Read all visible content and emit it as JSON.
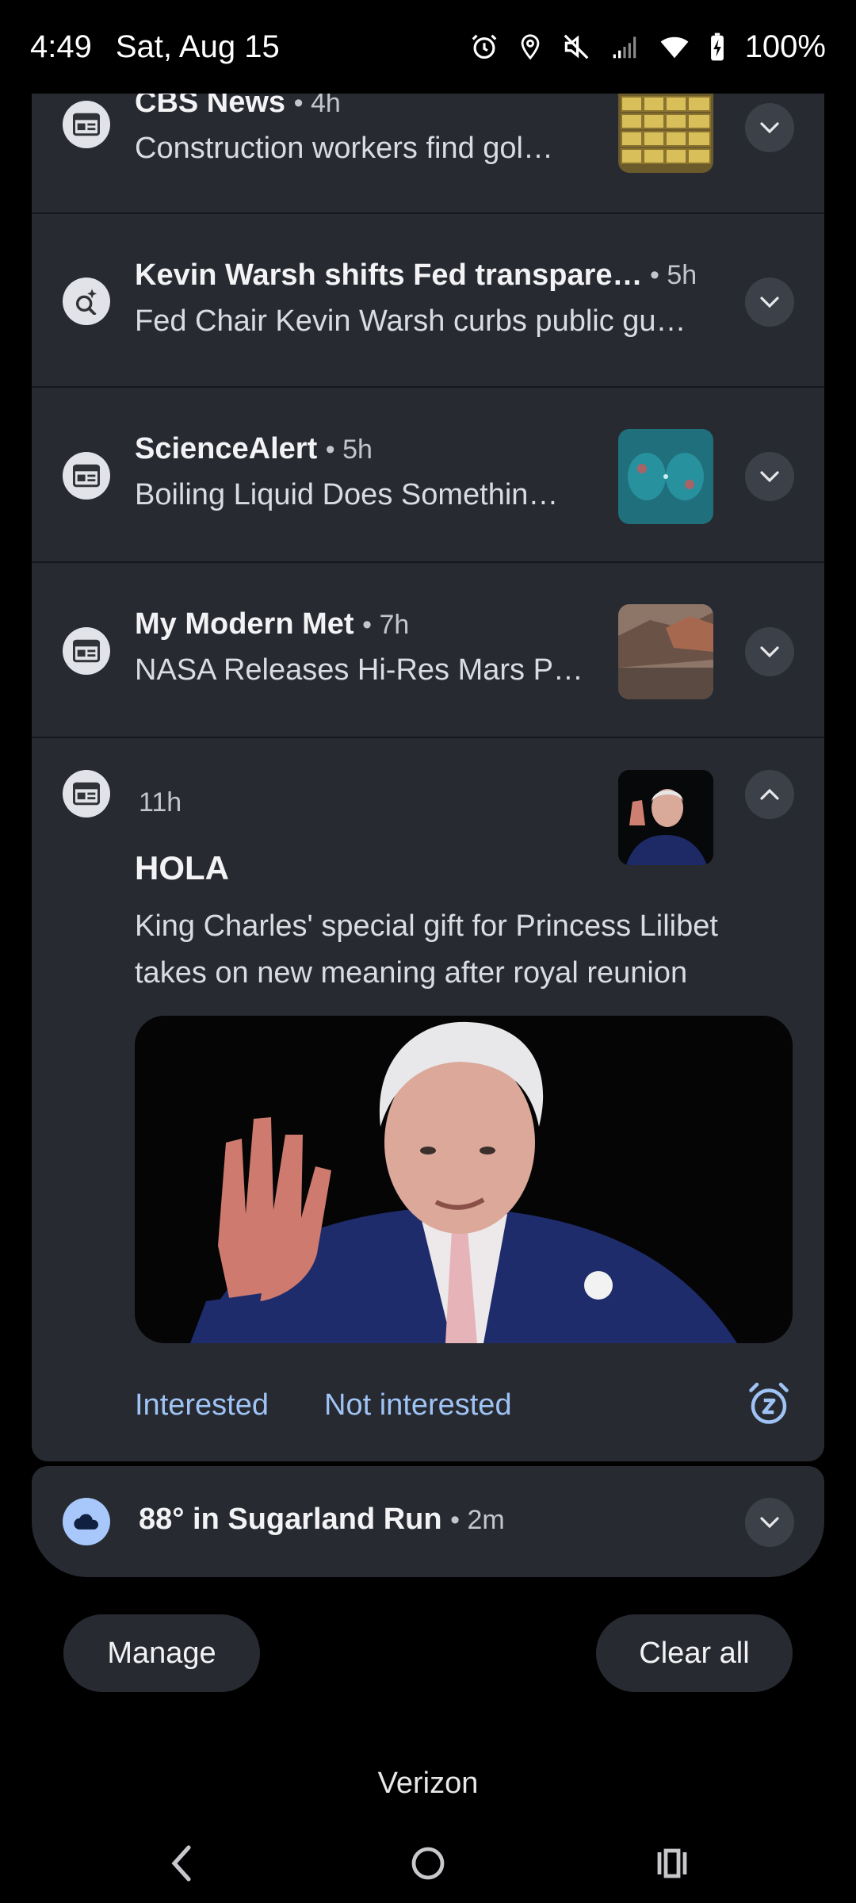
{
  "status_bar": {
    "time": "4:49",
    "date": "Sat, Aug 15",
    "battery": "100%",
    "icons": [
      "alarm-icon",
      "location-icon",
      "mute-icon",
      "signal-icon",
      "wifi-icon",
      "battery-charging-icon"
    ]
  },
  "notifications": [
    {
      "app_icon": "news-icon",
      "title": "CBS News",
      "time": "• 4h",
      "body": "Construction workers find gol…",
      "has_thumb": true
    },
    {
      "app_icon": "search-sparkle-icon",
      "title": "Kevin Warsh shifts Fed transpare…",
      "time": "• 5h",
      "body": "Fed Chair Kevin Warsh curbs public gu…",
      "has_thumb": false
    },
    {
      "app_icon": "news-icon",
      "title": "ScienceAlert",
      "time": "• 5h",
      "body": "Boiling Liquid Does Somethin…",
      "has_thumb": true
    },
    {
      "app_icon": "news-icon",
      "title": "My Modern Met",
      "time": "• 7h",
      "body": "NASA Releases Hi-Res Mars P…",
      "has_thumb": true
    }
  ],
  "expanded": {
    "app_icon": "news-icon",
    "time": "11h",
    "title": "HOLA",
    "body": "King Charles' special gift for Princess Lilibet takes on new meaning after royal reunion",
    "actions": [
      "Interested",
      "Not interested"
    ],
    "snooze_icon": "snooze-icon"
  },
  "weather": {
    "icon": "cloud-icon",
    "title": "88° in Sugarland Run",
    "time": "• 2m"
  },
  "buttons": {
    "manage": "Manage",
    "clear_all": "Clear all"
  },
  "carrier": "Verizon",
  "colors": {
    "background": "#000000",
    "card": "#272a31",
    "accent": "#9fc3f5",
    "weather_icon_bg": "#a8c7fa"
  }
}
